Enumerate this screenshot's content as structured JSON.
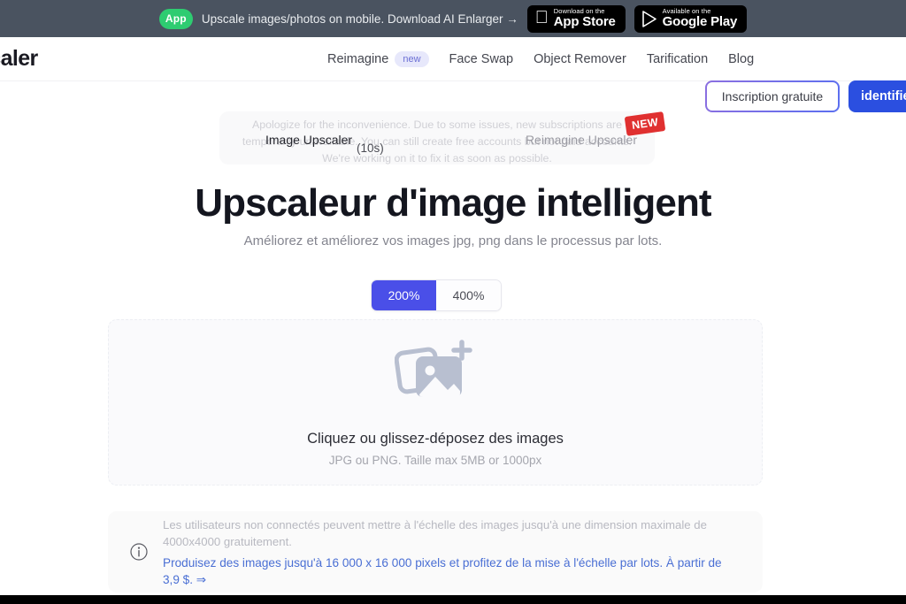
{
  "app_banner": {
    "pill_label": "App",
    "text": "Upscale images/photos on mobile. Download AI Enlarger →",
    "app_store": {
      "small": "Download on the",
      "big": "App Store",
      "icon": "apple-icon"
    },
    "google_play": {
      "small": "Available on the",
      "big": "Google Play",
      "icon": "google-play-icon"
    },
    "background_color": "#4a5360",
    "pill_color": "#2ecc71"
  },
  "nav": {
    "logo": "scaler",
    "links": [
      {
        "label": "Reimagine",
        "badge": "new"
      },
      {
        "label": "Face Swap",
        "badge": ""
      },
      {
        "label": "Object Remover",
        "badge": ""
      },
      {
        "label": "Tarification",
        "badge": ""
      },
      {
        "label": "Blog",
        "badge": ""
      }
    ],
    "signup_label": "Inscription gratuite",
    "login_label": "identifier",
    "login_color": "#2b4fe0"
  },
  "notification": {
    "ghost_text": "Apologize for the inconvenience. Due to some issues, new subscriptions are temporarily unavailable. You can still create free accounts but not paid accounts. We're working on it to fix it as soon as possible."
  },
  "mode_tabs": {
    "active_label": "Image Upscaler",
    "other_label": "Reimagine Upscaler",
    "badge": "NEW",
    "seconds": "(10s)"
  },
  "hero": {
    "title": "Upscaleur d'image intelligent",
    "subtitle": "Améliorez et améliorez vos images jpg, png dans le processus par lots."
  },
  "scale": {
    "options": [
      {
        "label": "200%",
        "selected": true
      },
      {
        "label": "400%",
        "selected": false
      }
    ],
    "active_color": "#4a4fe8"
  },
  "dropzone": {
    "icon": "add-images-icon",
    "main_text": "Cliquez ou glissez-déposez des images",
    "sub_text": "JPG ou PNG. Taille max 5MB or 1000px"
  },
  "notice": {
    "icon": "info-icon",
    "grey_text": "Les utilisateurs non connectés peuvent mettre à l'échelle des images jusqu'à une dimension maximale de 4000x4000 gratuitement.",
    "link_text": "Produisez des images jusqu'à 16 000 x 16 000 pixels et profitez de la mise à l'échelle par lots. À partir de 3,9 $. ⇒",
    "link_color": "#4a6fd4"
  }
}
